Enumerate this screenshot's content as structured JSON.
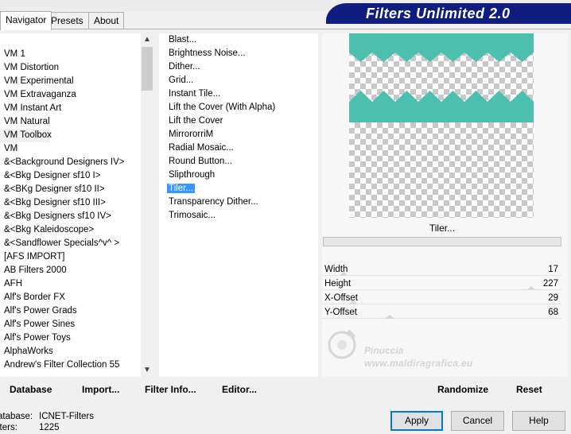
{
  "logo": {
    "text": "Filters Unlimited 2.0"
  },
  "tabs": [
    {
      "label": "Navigator",
      "active": true
    },
    {
      "label": "Presets",
      "active": false
    },
    {
      "label": "About",
      "active": false
    }
  ],
  "categories": {
    "items": [
      "VM 1",
      "VM Distortion",
      "VM Experimental",
      "VM Extravaganza",
      "VM Instant Art",
      "VM Natural",
      "VM Toolbox",
      "VM",
      "&<Background Designers IV>",
      "&<Bkg Designer sf10 I>",
      "&<BKg Designer sf10 II>",
      "&<Bkg Designer sf10 III>",
      "&<Bkg Designers sf10 IV>",
      "&<Bkg Kaleidoscope>",
      "&<Sandflower Specials^v^ >",
      "[AFS IMPORT]",
      "AB Filters 2000",
      "AFH",
      "Alf's Border FX",
      "Alf's Power Grads",
      "Alf's Power Sines",
      "Alf's Power Toys",
      "AlphaWorks",
      "Andrew's Filter Collection 55"
    ],
    "selected": "VM Toolbox"
  },
  "filters": {
    "items": [
      "Blast...",
      "Brightness Noise...",
      "Dither...",
      "Grid...",
      "Instant Tile...",
      "Lift the Cover (With Alpha)",
      "Lift the Cover",
      "MirrororriM",
      "Radial Mosaic...",
      "Round Button...",
      "Slipthrough",
      "Tiler...",
      "Transparency Dither...",
      "Trimosaic..."
    ],
    "selected": "Tiler..."
  },
  "preview": {
    "accent": "#4dbfae"
  },
  "current_filter": "Tiler...",
  "params": [
    {
      "label": "Width",
      "value": "17",
      "level": 0.07
    },
    {
      "label": "Height",
      "value": "227",
      "level": 0.89
    },
    {
      "label": "X-Offset",
      "value": "29",
      "level": 0.11
    },
    {
      "label": "Y-Offset",
      "value": "68",
      "level": 0.27
    }
  ],
  "watermark": {
    "name": "Pinuccia",
    "url": "www.maldiragrafica.eu"
  },
  "toolbar": {
    "database": "Database",
    "import": "Import...",
    "filter_info": "Filter Info...",
    "editor": "Editor...",
    "randomize": "Randomize",
    "reset": "Reset"
  },
  "status": {
    "database_label": "atabase:",
    "database_value": "ICNET-Filters",
    "filters_label": "lters:",
    "filters_value": "1225"
  },
  "dialog": {
    "apply": "Apply",
    "cancel": "Cancel",
    "help": "Help"
  }
}
